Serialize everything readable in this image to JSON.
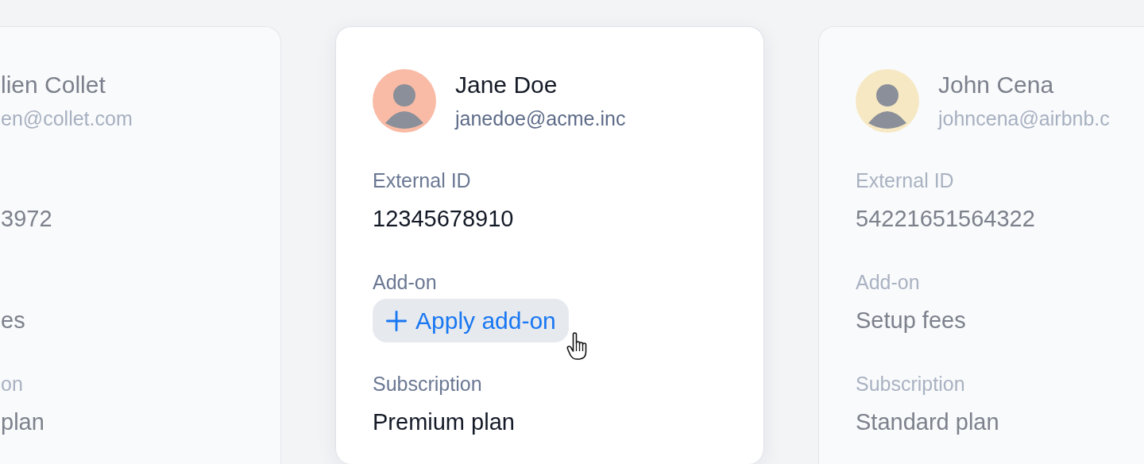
{
  "cards": [
    {
      "selected": false,
      "name": "lien Collet",
      "email": "en@collet.com",
      "fields": [
        {
          "kind": "text",
          "value": "3972"
        },
        {
          "kind": "text",
          "value": "es"
        },
        {
          "kind": "text",
          "label": "on",
          "value": "plan"
        }
      ]
    },
    {
      "selected": true,
      "color": "#f9bba5",
      "name": "Jane Doe",
      "email": "janedoe@acme.inc",
      "fields": [
        {
          "kind": "text",
          "label": "External ID",
          "value": "12345678910"
        },
        {
          "kind": "button",
          "label": "Add-on",
          "value": "Apply add-on",
          "hovered": true
        },
        {
          "kind": "text",
          "label": "Subscription",
          "value": "Premium plan"
        }
      ]
    },
    {
      "selected": false,
      "color": "#f6e8c3",
      "name": "John Cena",
      "email": "johncena@airbnb.c",
      "fields": [
        {
          "kind": "text",
          "label": "External ID",
          "value": "54221651564322"
        },
        {
          "kind": "text",
          "label": "Add-on",
          "value": "Setup fees"
        },
        {
          "kind": "text",
          "label": "Subscription",
          "value": "Standard plan"
        }
      ]
    }
  ]
}
